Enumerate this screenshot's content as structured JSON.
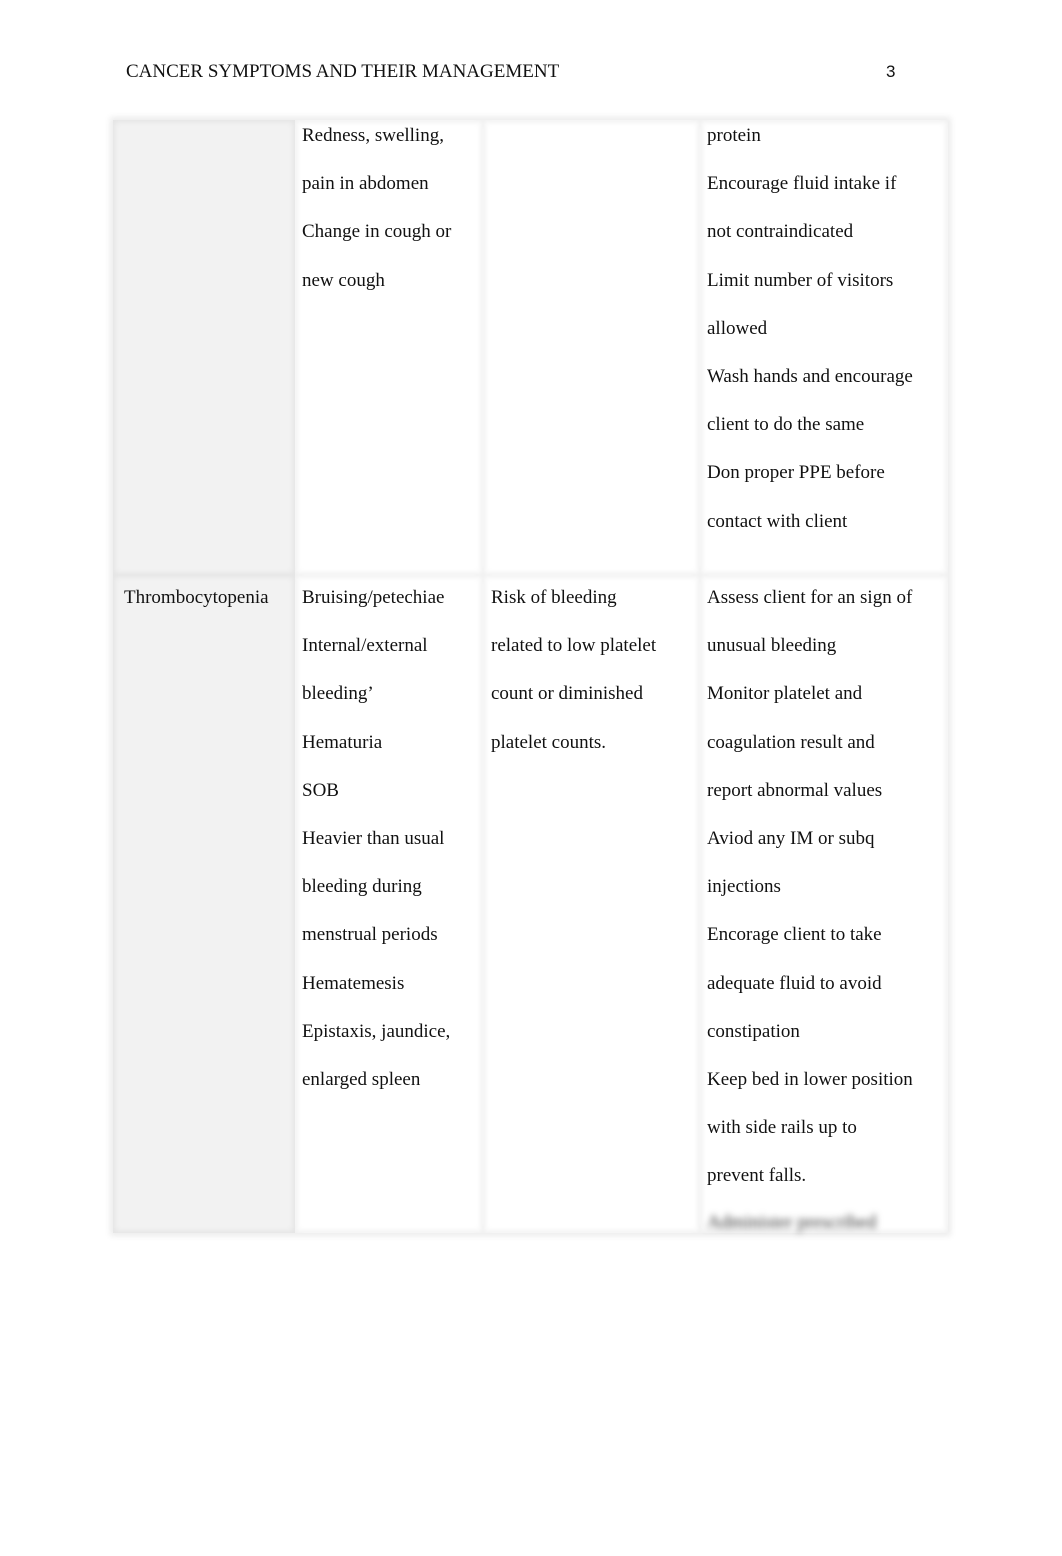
{
  "header": {
    "running_head": "CANCER SYMPTOMS AND THEIR MANAGEMENT",
    "page_number": "3"
  },
  "table": {
    "rows": [
      {
        "condition": [],
        "signs_symptoms": [
          "Redness, swelling,",
          "pain in abdomen",
          "Change in cough or",
          "new cough"
        ],
        "nursing_diagnosis": [],
        "interventions": [
          "protein",
          "Encourage fluid intake if",
          "not contraindicated",
          "Limit number of visitors",
          "allowed",
          "Wash hands and encourage",
          "client to do the same",
          " Don proper PPE before",
          "contact with client"
        ]
      },
      {
        "condition": [
          "Thrombocytopenia"
        ],
        "signs_symptoms": [
          "Bruising/petechiae",
          "Internal/external",
          "bleeding’",
          "Hematuria",
          "SOB",
          "Heavier than usual",
          "bleeding during",
          "menstrual periods",
          "Hematemesis",
          "Epistaxis, jaundice,",
          "enlarged spleen"
        ],
        "nursing_diagnosis": [
          "Risk of bleeding",
          "related to low platelet",
          "count or diminished",
          "platelet counts."
        ],
        "interventions": [
          "Assess client for an sign of",
          "unusual bleeding",
          "Monitor platelet and",
          "coagulation result and",
          "report abnormal values",
          "Aviod any IM or subq",
          "injections",
          "Encorage client to take",
          "adequate fluid to avoid",
          "constipation",
          "Keep bed in lower position",
          "with side rails up to",
          "prevent falls."
        ],
        "interventions_obscured_line": "Administer prescribed"
      }
    ]
  }
}
